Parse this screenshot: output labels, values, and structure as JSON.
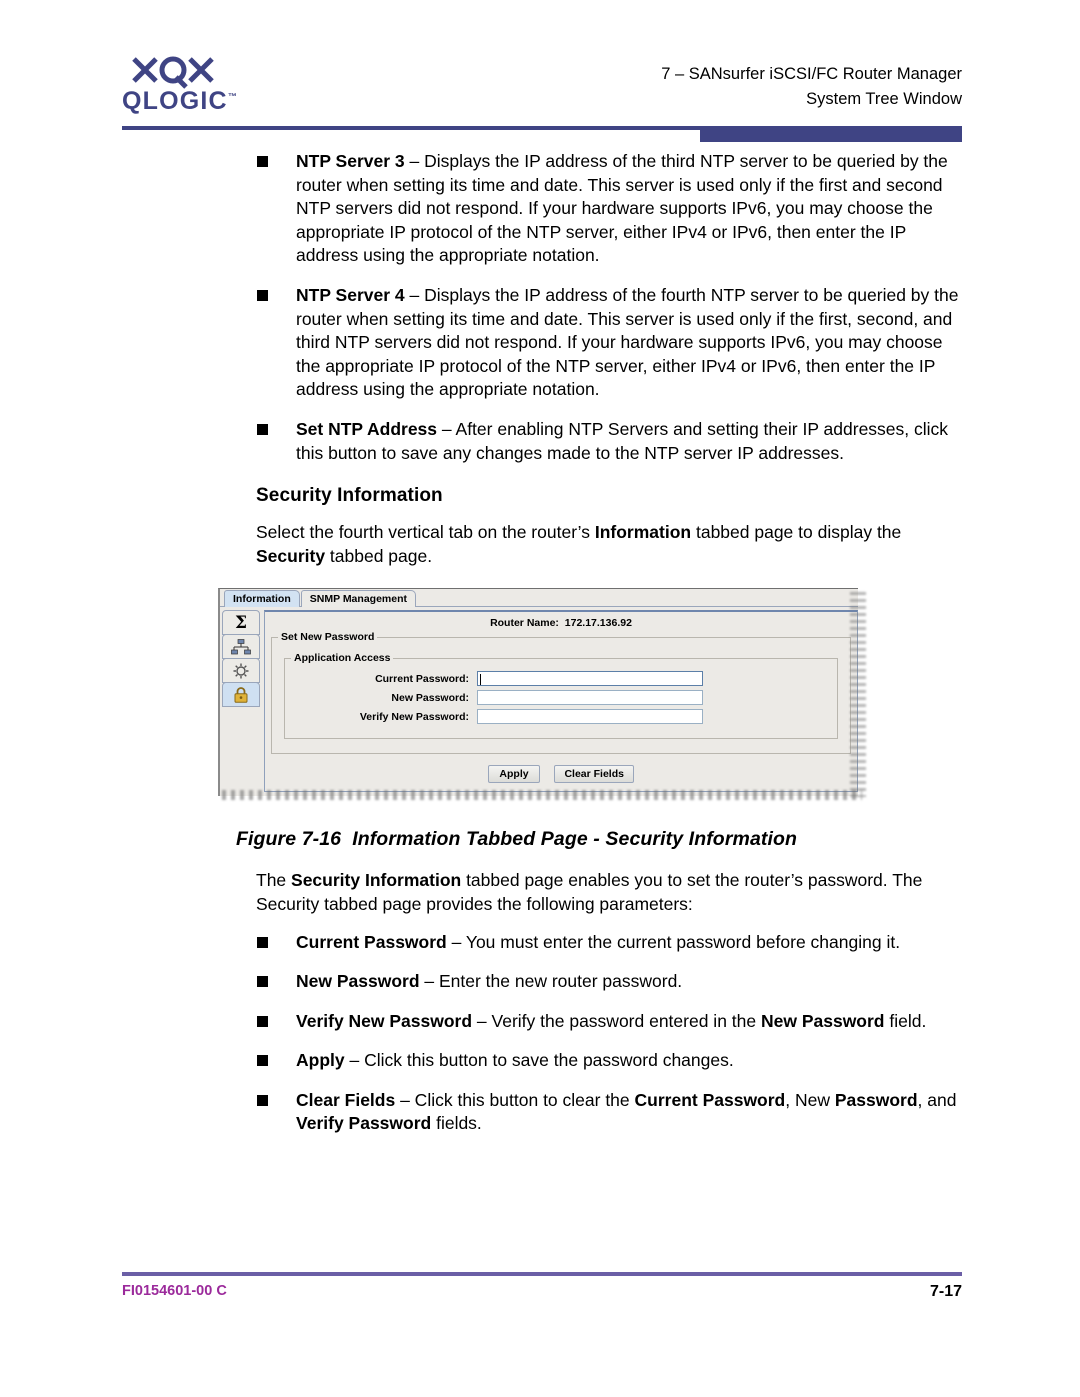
{
  "header": {
    "logo_text": "QLOGIC",
    "logo_tm": "™",
    "line1": "7 – SANsurfer iSCSI/FC Router Manager",
    "line2": "System Tree Window",
    "accent_color": "#3f4484"
  },
  "body": {
    "bullets_top": [
      {
        "term": "NTP Server 3",
        "text": " – Displays the IP address of the third NTP server to be queried by the router when setting its time and date. This server is used only if the first and second NTP servers did not respond. If your hardware supports IPv6, you may choose the appropriate IP protocol of the NTP server, either IPv4 or IPv6, then enter the IP address using the appropriate notation."
      },
      {
        "term": "NTP Server 4",
        "text": " – Displays the IP address of the fourth NTP server to be queried by the router when setting its time and date. This server is used only if the first, second, and third NTP servers did not respond. If your hardware supports IPv6, you may choose the appropriate IP protocol of the NTP server, either IPv4 or IPv6, then enter the IP address using the appropriate notation."
      },
      {
        "term": "Set NTP Address",
        "text": " – After enabling NTP Servers and setting their IP addresses, click this button to save any changes made to the NTP server IP addresses."
      }
    ],
    "section_heading": "Security Information",
    "intro_1a": "Select the fourth vertical tab on the router’s ",
    "intro_1b": "Information",
    "intro_1c": " tabbed page to display the ",
    "intro_1d": "Security",
    "intro_1e": " tabbed page.",
    "figure_caption_num": "Figure 7-16",
    "figure_caption_text": "Information Tabbed Page - Security Information",
    "after_fig_1a": "The ",
    "after_fig_1b": "Security Information",
    "after_fig_1c": " tabbed page enables you to set the router’s password. The Security tabbed page provides the following parameters:",
    "bullets_bottom": [
      {
        "term": "Current Password",
        "text": " – You must enter the current password before changing it."
      },
      {
        "term": "New Password",
        "text": " – Enter the new router password."
      },
      {
        "term": "Verify New Password",
        "text": " – Verify the password entered in the ",
        "term2": "New Password",
        "text2": " field."
      },
      {
        "term": "Apply",
        "text": " – Click this button to save the password changes."
      },
      {
        "term": "Clear Fields",
        "text": " – Click this button to clear the ",
        "term2": "Current Password",
        "text2": ", New ",
        "term3": "Password",
        "text3": ", and ",
        "term4": "Verify Password",
        "text4": " fields."
      }
    ]
  },
  "figure": {
    "tabs": [
      {
        "label": "Information",
        "selected": true
      },
      {
        "label": "SNMP Management",
        "selected": false
      }
    ],
    "vertical_tabs": [
      {
        "icon": "sigma-icon",
        "glyph": "Σ",
        "selected": false
      },
      {
        "icon": "network-topology-icon",
        "glyph": "",
        "selected": false
      },
      {
        "icon": "gear-icon",
        "glyph": "",
        "selected": false
      },
      {
        "icon": "lock-icon",
        "glyph": "",
        "selected": true
      }
    ],
    "router_name_label": "Router Name:",
    "router_name_value": "172.17.136.92",
    "group_outer_label": "Set New Password",
    "group_inner_label": "Application Access",
    "fields": [
      {
        "label": "Current Password:",
        "value": "",
        "focused": true
      },
      {
        "label": "New Password:",
        "value": "",
        "focused": false
      },
      {
        "label": "Verify New Password:",
        "value": "",
        "focused": false
      }
    ],
    "buttons": [
      {
        "label": "Apply"
      },
      {
        "label": "Clear Fields"
      }
    ]
  },
  "footer": {
    "doc_id": "FI0154601-00  C",
    "page_number": "7-17",
    "rule_color": "#6b5fa6",
    "doc_id_color": "#9b2a9b"
  }
}
